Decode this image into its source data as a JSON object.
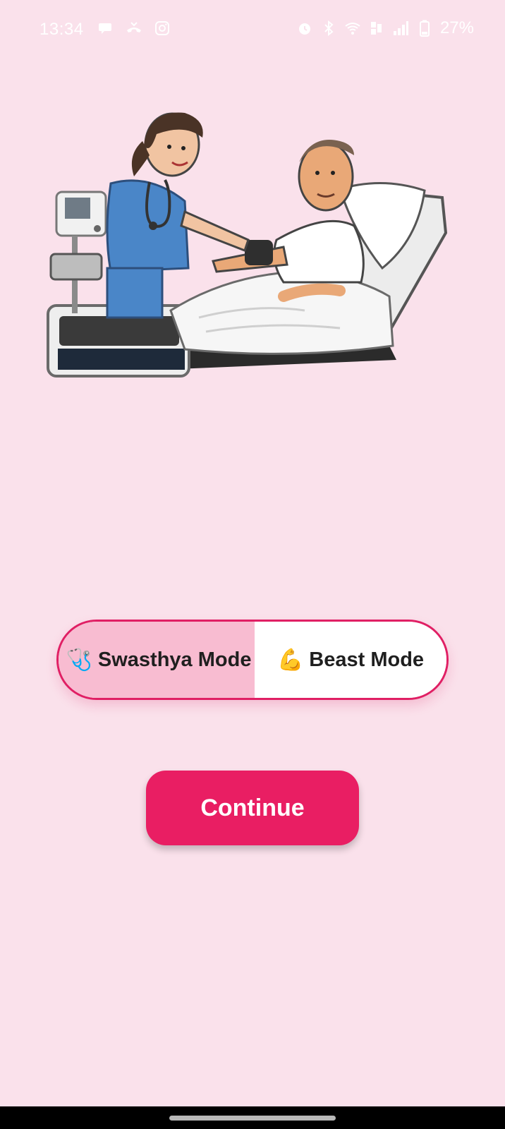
{
  "status_bar": {
    "time": "13:34",
    "battery": "27%",
    "left_icons": [
      "chat-bubble-icon",
      "missed-call-icon",
      "instagram-icon"
    ],
    "right_icons": [
      "alarm-icon",
      "bluetooth-icon",
      "wifi-icon",
      "volte-icon",
      "signal-icon",
      "battery-icon"
    ]
  },
  "illustration": {
    "subject": "nurse-measuring-blood-pressure-of-patient-in-bed"
  },
  "mode_toggle": {
    "options": [
      {
        "label": "Swasthya Mode",
        "icon": "🩺",
        "selected": true
      },
      {
        "label": "Beast Mode",
        "icon": "💪",
        "selected": false
      }
    ],
    "border_color": "#e01f64",
    "selected_color": "#f8bcd1"
  },
  "continue_button": {
    "label": "Continue",
    "color": "#e91e63"
  },
  "colors": {
    "background": "#fae1eb"
  }
}
